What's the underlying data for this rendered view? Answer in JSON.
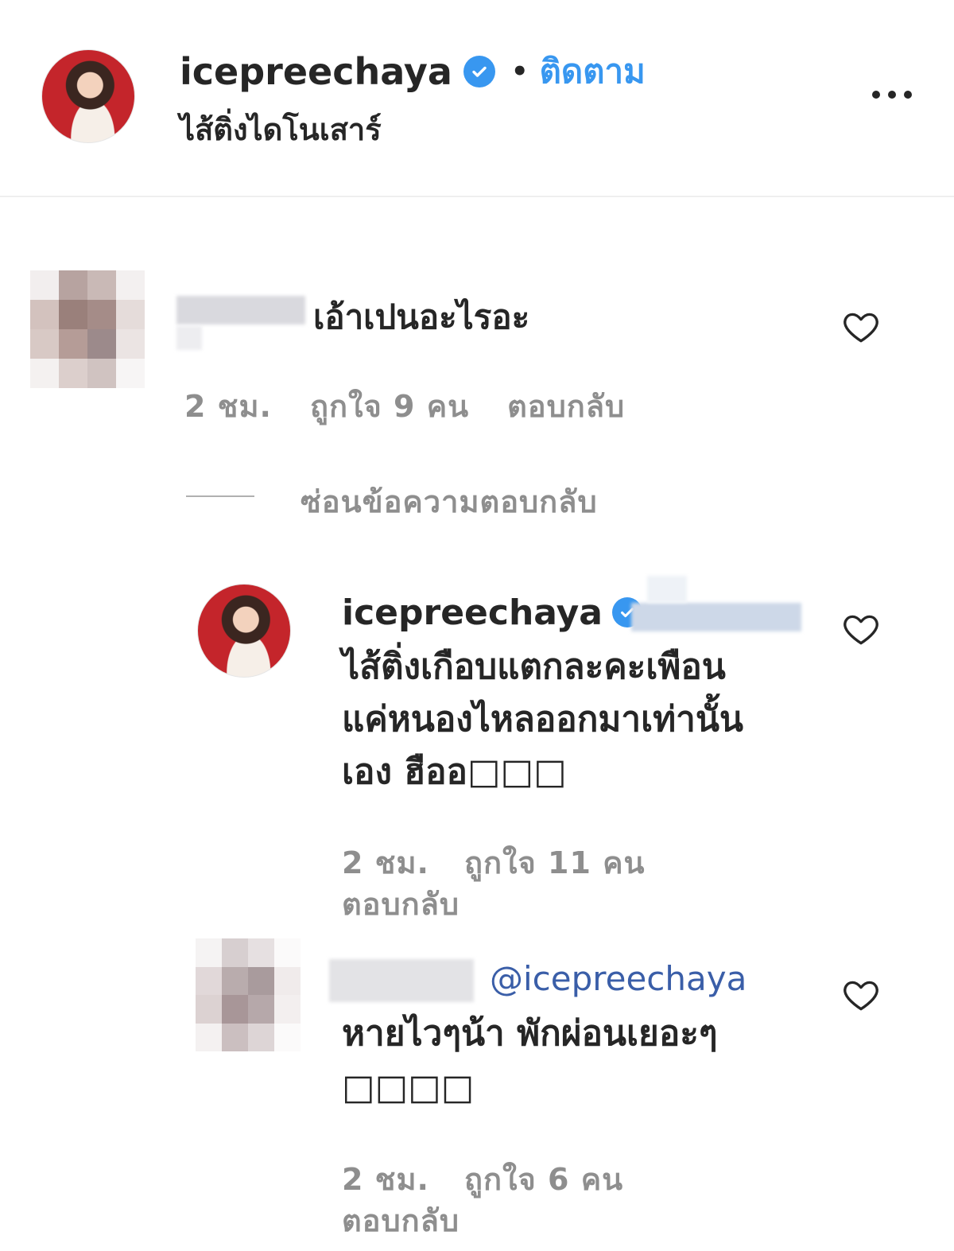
{
  "header": {
    "username": "icepreechaya",
    "separator": "•",
    "follow_label": "ติดตาม",
    "caption": "ไส้ติ่งไดโนเสาร์",
    "more_label": "•••"
  },
  "comments": [
    {
      "text": "เอ้าเปนอะไรอะ",
      "time": "2 ชม.",
      "likes": "ถูกใจ 9 คน",
      "reply_label": "ตอบกลับ"
    }
  ],
  "hide_replies_label": "ซ่อนข้อความตอบกลับ",
  "replies": [
    {
      "username": "icepreechaya",
      "text_line1": "ไส้ติ่งเกือบแตกละคะเพือน",
      "text_line2": "แค่หนองไหลออกมาเท่านั้น",
      "text_line3": "เอง ฮืออ□□□",
      "time": "2 ชม.",
      "likes": "ถูกใจ 11 คน",
      "reply_label": "ตอบกลับ"
    },
    {
      "mention": "@icepreechaya",
      "text_line1": "หายไวๆน้า พักผ่อนเยอะๆ",
      "text_line2": "□□□□",
      "time": "2 ชม.",
      "likes": "ถูกใจ 6 คน",
      "reply_label": "ตอบกลับ"
    }
  ],
  "icons": {
    "verified": "verified-badge-icon",
    "heart": "heart-outline-icon",
    "more": "more-dots-icon"
  },
  "colors": {
    "link_blue": "#3897f0",
    "meta_gray": "#8e8e8e",
    "text": "#262626"
  }
}
